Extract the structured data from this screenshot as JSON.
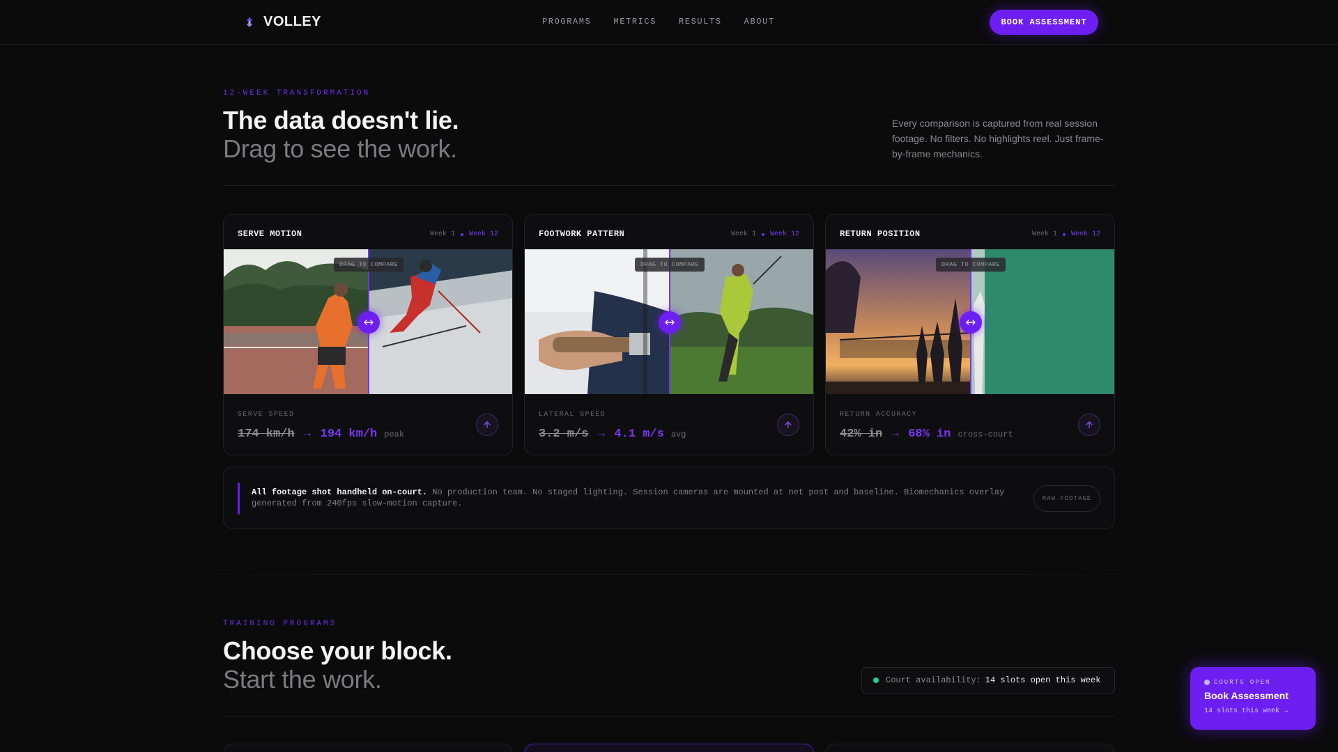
{
  "nav": {
    "brand": "VOLLEY",
    "links": [
      "PROGRAMS",
      "METRICS",
      "RESULTS",
      "ABOUT"
    ],
    "cta": "BOOK ASSESSMENT"
  },
  "hero": {
    "eyebrow": "12-WEEK TRANSFORMATION",
    "title": "The data doesn't lie.",
    "subtitle": "Drag to see the work.",
    "intro": "Every comparison is captured from real session footage. No filters. No highlights reel. Just frame-by-frame mechanics."
  },
  "cards": [
    {
      "title": "SERVE MOTION",
      "week_before": "Week 1",
      "week_after": "Week 12",
      "drag_label": "DRAG TO COMPARE",
      "metric_label": "SERVE SPEED",
      "before": "174 km/h",
      "after": "194 km/h",
      "unit": "peak"
    },
    {
      "title": "FOOTWORK PATTERN",
      "week_before": "Week 1",
      "week_after": "Week 12",
      "drag_label": "DRAG TO COMPARE",
      "metric_label": "LATERAL SPEED",
      "before": "3.2 m/s",
      "after": "4.1 m/s",
      "unit": "avg"
    },
    {
      "title": "RETURN POSITION",
      "week_before": "Week 1",
      "week_after": "Week 12",
      "drag_label": "DRAG TO COMPARE",
      "metric_label": "RETURN ACCURACY",
      "before": "42% in",
      "after": "68% in",
      "unit": "cross-court"
    }
  ],
  "arrow": "→",
  "note": {
    "strong": "All footage shot handheld on-court.",
    "text": " No production team. No staged lighting. Session cameras are mounted at net post and baseline. Biomechanics overlay generated from 240fps slow-motion capture.",
    "button": "RAW FOOTAGE"
  },
  "programs": {
    "eyebrow": "TRAINING PROGRAMS",
    "title": "Choose your block.",
    "subtitle": "Start the work.",
    "availability_label": "Court availability:",
    "availability_value": "14 slots open this week"
  },
  "floating": {
    "eyebrow": "COURTS OPEN",
    "title": "Book Assessment",
    "sub": "14 slots this week →"
  },
  "colors": {
    "accent": "#6d1ff2",
    "background": "#0b0b0c",
    "status_green": "#1fd18a"
  }
}
